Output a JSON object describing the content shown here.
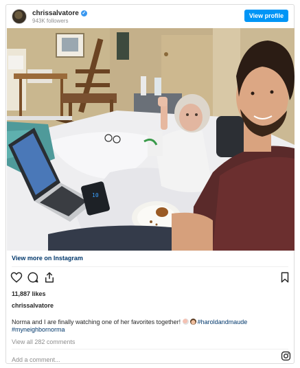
{
  "header": {
    "username": "chrissalvatore",
    "followers": "943K followers",
    "view_profile_label": "View profile"
  },
  "post": {
    "view_more_label": "View more on Instagram",
    "likes": "11,887 likes",
    "caption_username": "chrissalvatore",
    "caption_text": "Norma and I are finally watching one of her favorites together!",
    "hashtag_1": "#haroldandmaude",
    "hashtag_2": "#myneighbornorma",
    "view_comments_label": "View all 282 comments",
    "add_comment_placeholder": "Add a comment..."
  },
  "icons": {
    "verified": "verified-badge-icon",
    "like": "heart-icon",
    "comment": "comment-icon",
    "share": "share-icon",
    "save": "bookmark-icon",
    "instagram": "instagram-logo-icon"
  },
  "colors": {
    "button_blue": "#0095f6",
    "link_blue": "#00376b",
    "muted_gray": "#8e8e8e"
  }
}
